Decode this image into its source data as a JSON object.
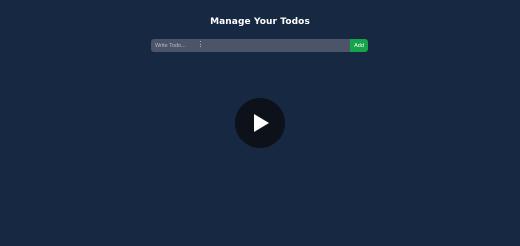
{
  "header": {
    "title": "Manage Your Todos"
  },
  "todo_form": {
    "input_placeholder": "Write Todo...",
    "input_value": "",
    "add_label": "Add"
  },
  "overlay": {
    "play_icon": "play-icon"
  },
  "colors": {
    "background": "#172842",
    "input_background": "#4b5468",
    "add_button": "#16a34a",
    "play_button": "#0c111a"
  }
}
